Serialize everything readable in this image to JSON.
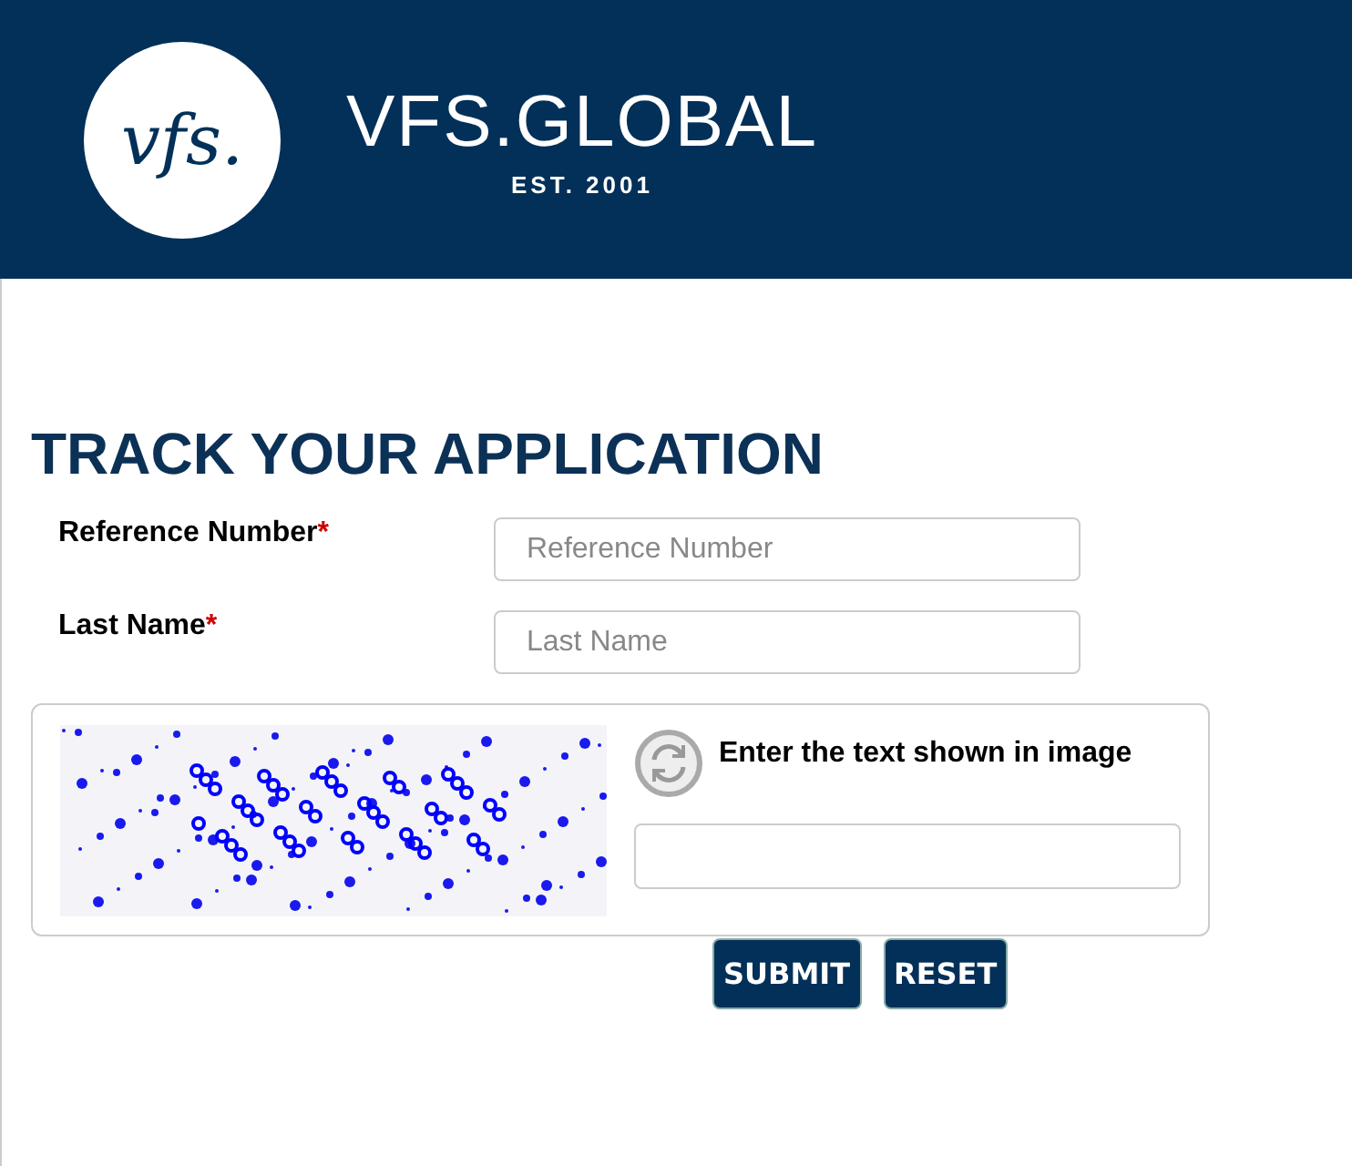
{
  "header": {
    "logo_mark": "vfs.",
    "brand": "VFS.GLOBAL",
    "tagline": "EST. 2001"
  },
  "title": "TRACK YOUR APPLICATION",
  "fields": [
    {
      "label": "Reference Number",
      "required_mark": "*",
      "placeholder": "Reference Number"
    },
    {
      "label": "Last Name",
      "required_mark": "*",
      "placeholder": "Last Name"
    }
  ],
  "captcha": {
    "prompt": "Enter the text shown in image"
  },
  "buttons": [
    "SUBMIT",
    "RESET"
  ]
}
